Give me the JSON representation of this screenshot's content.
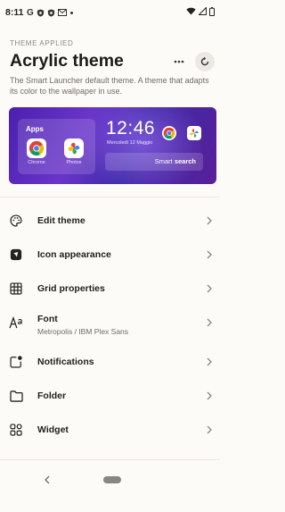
{
  "status_bar": {
    "time": "8:11",
    "left_icons": [
      "google-icon",
      "shield-icon",
      "shield-icon",
      "gmail-icon"
    ],
    "right_icons": [
      "wifi-icon",
      "signal-icon",
      "battery-icon"
    ]
  },
  "header": {
    "kicker": "THEME APPLIED",
    "title": "Acrylic theme",
    "description": "The Smart Launcher default theme. A theme that adapts its color to the wallpaper in use."
  },
  "preview": {
    "apps_title": "Apps",
    "apps": [
      {
        "label": "Chrome",
        "icon": "chrome-icon"
      },
      {
        "label": "Photos",
        "icon": "photos-icon"
      }
    ],
    "clock": "12:46",
    "date": "Mercoledì 12 Maggio",
    "search_prefix": "Smart ",
    "search_bold": "search"
  },
  "menu": [
    {
      "label": "Edit theme",
      "icon": "palette-icon"
    },
    {
      "label": "Icon appearance",
      "icon": "icon-shape-icon"
    },
    {
      "label": "Grid properties",
      "icon": "grid-icon"
    },
    {
      "label": "Font",
      "sublabel": "Metropolis / IBM Plex Sans",
      "icon": "font-icon"
    },
    {
      "label": "Notifications",
      "icon": "notification-badge-icon"
    },
    {
      "label": "Folder",
      "icon": "folder-icon"
    },
    {
      "label": "Widget",
      "icon": "widget-icon"
    }
  ],
  "colors": {
    "background": "#fdfbf8",
    "preview_gradient_start": "#4a1fb0",
    "preview_gradient_end": "#5a1f9a",
    "text_primary": "#1f1f1f",
    "text_secondary": "#6f6c68"
  }
}
